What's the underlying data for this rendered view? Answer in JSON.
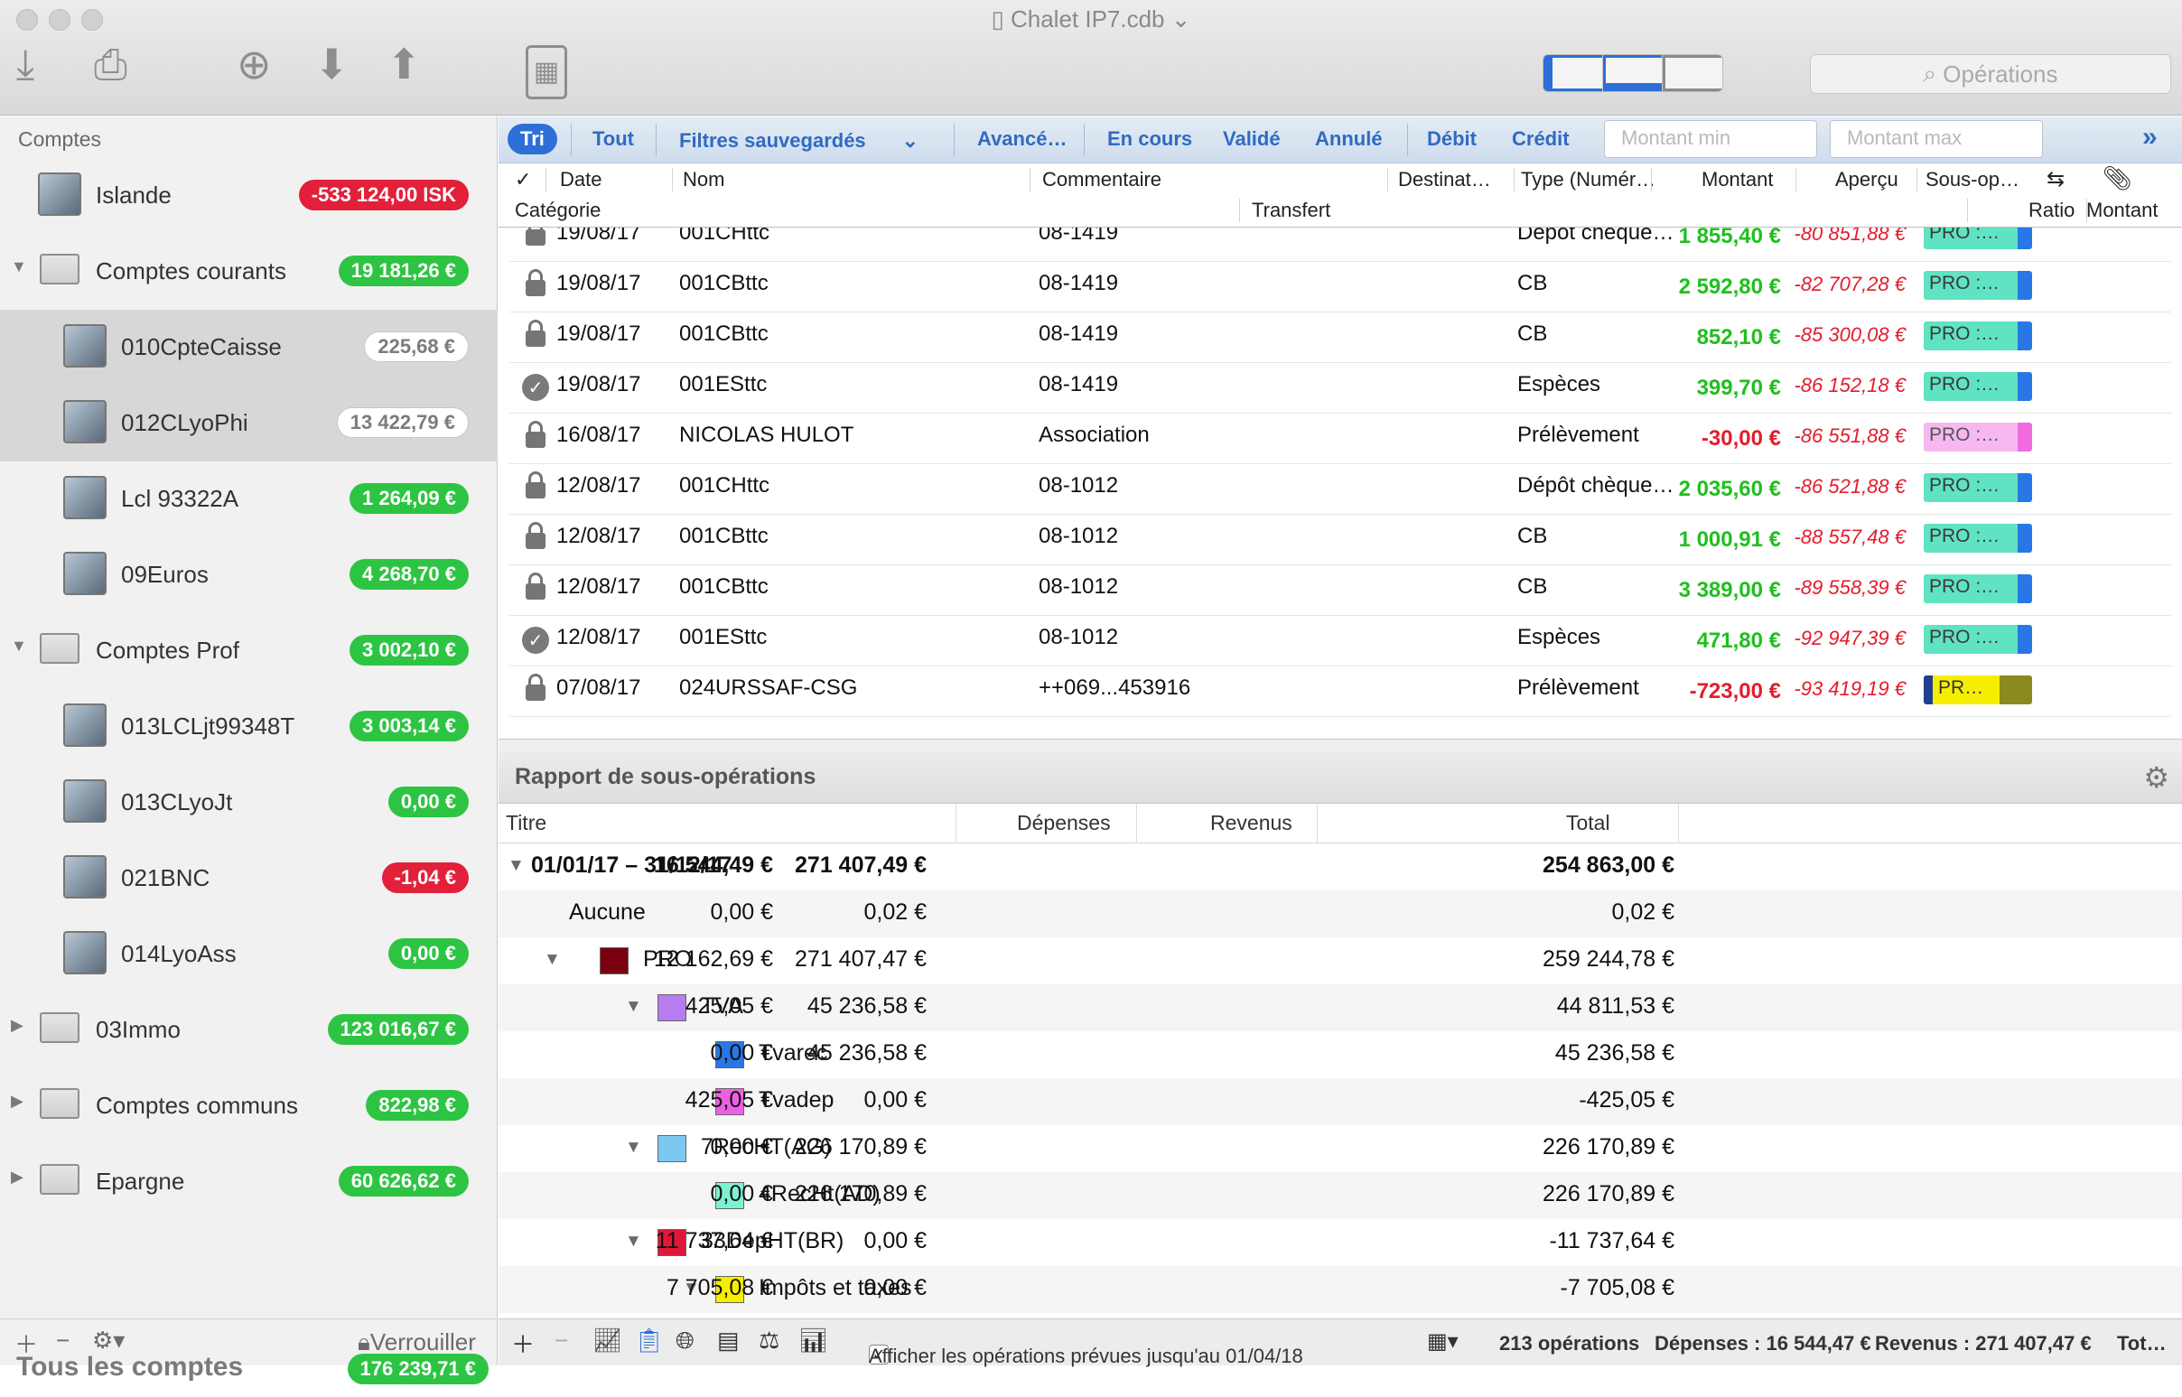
{
  "window": {
    "title": "Chalet IP7.cdb"
  },
  "toolbar": {
    "search_placeholder": "Opérations"
  },
  "sidebar": {
    "header": "Comptes",
    "accounts": [
      {
        "name": "Islande",
        "balance": "-533 124,00 ISK",
        "status": "red",
        "kind": "account",
        "level": 0
      },
      {
        "name": "Comptes courants",
        "balance": "19 181,26 €",
        "status": "green",
        "kind": "folder",
        "level": 0
      },
      {
        "name": "010CpteCaisse",
        "balance": "225,68 €",
        "status": "grey",
        "kind": "account",
        "level": 1,
        "selected": true
      },
      {
        "name": "012CLyoPhi",
        "balance": "13 422,79 €",
        "status": "grey",
        "kind": "account",
        "level": 1,
        "selected": true
      },
      {
        "name": "Lcl 93322A",
        "balance": "1 264,09 €",
        "status": "green",
        "kind": "account",
        "level": 1
      },
      {
        "name": "09Euros",
        "balance": "4 268,70 €",
        "status": "green",
        "kind": "account",
        "level": 1
      },
      {
        "name": "Comptes Prof",
        "balance": "3 002,10 €",
        "status": "green",
        "kind": "folder",
        "level": 0
      },
      {
        "name": "013LCLjt99348T",
        "balance": "3 003,14 €",
        "status": "green",
        "kind": "account",
        "level": 1
      },
      {
        "name": "013CLyoJt",
        "balance": "0,00 €",
        "status": "green",
        "kind": "account",
        "level": 1
      },
      {
        "name": "021BNC",
        "balance": "-1,04 €",
        "status": "red",
        "kind": "account",
        "level": 1
      },
      {
        "name": "014LyoAss",
        "balance": "0,00 €",
        "status": "green",
        "kind": "account",
        "level": 1
      },
      {
        "name": "03Immo",
        "balance": "123 016,67 €",
        "status": "green",
        "kind": "folder",
        "level": 0
      },
      {
        "name": "Comptes communs",
        "balance": "822,98 €",
        "status": "green",
        "kind": "folder",
        "level": 0
      },
      {
        "name": "Epargne",
        "balance": "60 626,62 €",
        "status": "green",
        "kind": "folder",
        "level": 0
      }
    ],
    "total_label": "Tous les comptes",
    "total_balance": "176 239,71 €",
    "footer": {
      "lock_label": "Verrouiller"
    }
  },
  "filters": {
    "tri": "Tri",
    "tout": "Tout",
    "saved": "Filtres sauvegardés",
    "advanced": "Avancé…",
    "en_cours": "En cours",
    "valide": "Validé",
    "annule": "Annulé",
    "debit": "Débit",
    "credit": "Crédit",
    "min_placeholder": "Montant min",
    "max_placeholder": "Montant max"
  },
  "ops_columns": {
    "check": "✓",
    "date": "Date",
    "nom": "Nom",
    "commentaire": "Commentaire",
    "destinataire": "Destinat…",
    "type": "Type (Numér…",
    "montant": "Montant",
    "apercu": "Aperçu",
    "sousop": "Sous-op…",
    "categorie": "Catégorie",
    "transfert": "Transfert",
    "ratio": "Ratio",
    "montant2": "Montant"
  },
  "operations": [
    {
      "state": "lock",
      "date": "19/08/17",
      "nom": "001CHttc",
      "commentaire": "08-1419",
      "type": "Dépôt chèque…",
      "montant": "1 855,40 €",
      "sign": "pos",
      "apercu": "-80 851,88 €",
      "tag": "PRO :…",
      "tagc": "teal"
    },
    {
      "state": "lock",
      "date": "19/08/17",
      "nom": "001CBttc",
      "commentaire": "08-1419",
      "type": "CB",
      "montant": "2 592,80 €",
      "sign": "pos",
      "apercu": "-82 707,28 €",
      "tag": "PRO :…",
      "tagc": "teal"
    },
    {
      "state": "lock",
      "date": "19/08/17",
      "nom": "001CBttc",
      "commentaire": "08-1419",
      "type": "CB",
      "montant": "852,10 €",
      "sign": "pos",
      "apercu": "-85 300,08 €",
      "tag": "PRO :…",
      "tagc": "teal"
    },
    {
      "state": "check",
      "date": "19/08/17",
      "nom": "001ESttc",
      "commentaire": "08-1419",
      "type": "Espèces",
      "montant": "399,70 €",
      "sign": "pos",
      "apercu": "-86 152,18 €",
      "tag": "PRO :…",
      "tagc": "teal"
    },
    {
      "state": "lock",
      "date": "16/08/17",
      "nom": "NICOLAS HULOT",
      "commentaire": "Association",
      "type": "Prélèvement",
      "montant": "-30,00 €",
      "sign": "neg",
      "apercu": "-86 551,88 €",
      "tag": "PRO :…",
      "tagc": "pink"
    },
    {
      "state": "lock",
      "date": "12/08/17",
      "nom": "001CHttc",
      "commentaire": "08-1012",
      "type": "Dépôt chèque…",
      "montant": "2 035,60 €",
      "sign": "pos",
      "apercu": "-86 521,88 €",
      "tag": "PRO :…",
      "tagc": "teal"
    },
    {
      "state": "lock",
      "date": "12/08/17",
      "nom": "001CBttc",
      "commentaire": "08-1012",
      "type": "CB",
      "montant": "1 000,91 €",
      "sign": "pos",
      "apercu": "-88 557,48 €",
      "tag": "PRO :…",
      "tagc": "teal"
    },
    {
      "state": "lock",
      "date": "12/08/17",
      "nom": "001CBttc",
      "commentaire": "08-1012",
      "type": "CB",
      "montant": "3 389,00 €",
      "sign": "pos",
      "apercu": "-89 558,39 €",
      "tag": "PRO :…",
      "tagc": "teal"
    },
    {
      "state": "check",
      "date": "12/08/17",
      "nom": "001ESttc",
      "commentaire": "08-1012",
      "type": "Espèces",
      "montant": "471,80 €",
      "sign": "pos",
      "apercu": "-92 947,39 €",
      "tag": "PRO :…",
      "tagc": "teal"
    },
    {
      "state": "lock",
      "date": "07/08/17",
      "nom": "024URSSAF-CSG",
      "commentaire": "++069...453916",
      "type": "Prélèvement",
      "montant": "-723,00 €",
      "sign": "neg",
      "apercu": "-93 419,19 €",
      "tag": "PR…",
      "tagc": "yellow"
    }
  ],
  "report": {
    "title": "Rapport de sous-opérations",
    "columns": {
      "titre": "Titre",
      "depenses": "Dépenses",
      "revenus": "Revenus",
      "total": "Total"
    },
    "rows": [
      {
        "label": "01/01/17 – 31/12/17",
        "depenses": "16 544,49 €",
        "revenus": "271 407,49 €",
        "total": "254 863,00 €",
        "level": 0,
        "bold": true,
        "toggle": true
      },
      {
        "label": "Aucune",
        "depenses": "0,00 €",
        "revenus": "0,02 €",
        "total": "0,02 €",
        "level": 1
      },
      {
        "label": "PRO",
        "depenses": "12 162,69 €",
        "revenus": "271 407,47 €",
        "total": "259 244,78 €",
        "level": 1,
        "toggle": true,
        "color": "#7a0010"
      },
      {
        "label": "TVA",
        "depenses": "425,05 €",
        "revenus": "45 236,58 €",
        "total": "44 811,53 €",
        "level": 2,
        "toggle": true,
        "color": "#b77cf0"
      },
      {
        "label": "Tvarec",
        "depenses": "0,00 €",
        "revenus": "45 236,58 €",
        "total": "45 236,58 €",
        "level": 3,
        "color": "#2977e6"
      },
      {
        "label": "Tvadep",
        "depenses": "425,05 €",
        "revenus": "0,00 €",
        "total": "-425,05 €",
        "level": 3,
        "color": "#ee60e3"
      },
      {
        "label": "7RecHT(AG)",
        "depenses": "0,00 €",
        "revenus": "226 170,89 €",
        "total": "226 170,89 €",
        "level": 2,
        "toggle": true,
        "color": "#7bc9f3"
      },
      {
        "label": "4RecHt(AD)",
        "depenses": "0,00 €",
        "revenus": "226 170,89 €",
        "total": "226 170,89 €",
        "level": 3,
        "color": "#7ff0d2"
      },
      {
        "label": "33DepHT(BR)",
        "depenses": "11 737,64 €",
        "revenus": "0,00 €",
        "total": "-11 737,64 €",
        "level": 2,
        "toggle": true,
        "color": "#e0173a"
      },
      {
        "label": "Impôts et taxes",
        "depenses": "7 705,08 €",
        "revenus": "0,00 €",
        "total": "-7 705,08 €",
        "level": 3,
        "toggle": true,
        "color": "#f5ee00"
      }
    ]
  },
  "footer": {
    "show_planned": "Afficher les opérations prévues jusqu'au 01/04/18",
    "count": "213 opérations",
    "depenses": "Dépenses : 16 544,47 €",
    "revenus": "Revenus : 271 407,47 €",
    "total": "Tot…"
  }
}
